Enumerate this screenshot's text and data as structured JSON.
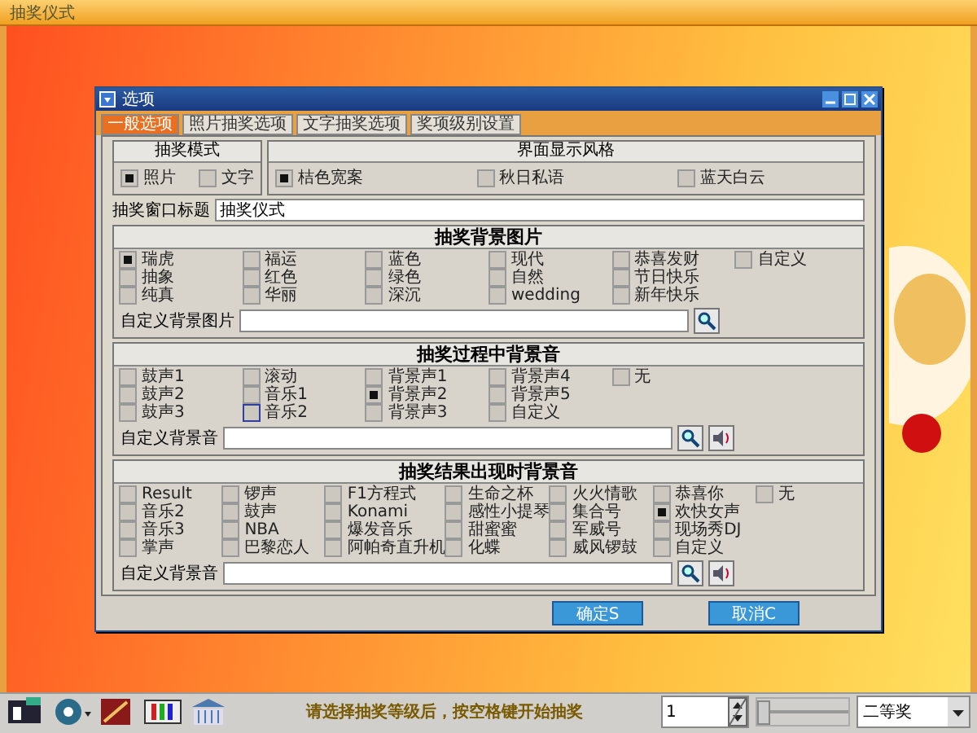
{
  "window": {
    "title": "抽奖仪式"
  },
  "dialog": {
    "title": "选项",
    "tabs": [
      {
        "label": "一般选项",
        "selected": true
      },
      {
        "label": "照片抽奖选项",
        "selected": false
      },
      {
        "label": "文字抽奖选项",
        "selected": false
      },
      {
        "label": "奖项级别设置",
        "selected": false
      }
    ],
    "mode_panel": {
      "heading": "抽奖模式",
      "options": [
        {
          "label": "照片",
          "checked": true
        },
        {
          "label": "文字",
          "checked": false
        }
      ]
    },
    "style_panel": {
      "heading": "界面显示风格",
      "options": [
        {
          "label": "桔色宽案",
          "checked": true
        },
        {
          "label": "秋日私语",
          "checked": false
        },
        {
          "label": "蓝天白云",
          "checked": false
        }
      ]
    },
    "title_field": {
      "label": "抽奖窗口标题",
      "value": "抽奖仪式"
    },
    "sections": [
      {
        "heading": "抽奖背景图片",
        "rows": [
          [
            {
              "label": "瑞虎",
              "checked": true
            },
            {
              "label": "福运",
              "checked": false
            },
            {
              "label": "蓝色",
              "checked": false
            },
            {
              "label": "现代",
              "checked": false
            },
            {
              "label": "恭喜发财",
              "checked": false
            },
            {
              "label": "自定义",
              "checked": false
            }
          ],
          [
            {
              "label": "抽象",
              "checked": false
            },
            {
              "label": "红色",
              "checked": false
            },
            {
              "label": "绿色",
              "checked": false
            },
            {
              "label": "自然",
              "checked": false
            },
            {
              "label": "节日快乐",
              "checked": false
            }
          ],
          [
            {
              "label": "纯真",
              "checked": false
            },
            {
              "label": "华丽",
              "checked": false
            },
            {
              "label": "深沉",
              "checked": false
            },
            {
              "label": "wedding",
              "checked": false
            },
            {
              "label": "新年快乐",
              "checked": false
            }
          ]
        ],
        "custom": {
          "label": "自定义背景图片",
          "kind": "image"
        }
      },
      {
        "heading": "抽奖过程中背景音",
        "rows": [
          [
            {
              "label": "鼓声1",
              "checked": false
            },
            {
              "label": "滚动",
              "checked": false
            },
            {
              "label": "背景声1",
              "checked": false
            },
            {
              "label": "背景声4",
              "checked": false
            },
            {
              "label": "无",
              "checked": false
            }
          ],
          [
            {
              "label": "鼓声2",
              "checked": false
            },
            {
              "label": "音乐1",
              "checked": false
            },
            {
              "label": "背景声2",
              "checked": true
            },
            {
              "label": "背景声5",
              "checked": false
            }
          ],
          [
            {
              "label": "鼓声3",
              "checked": false
            },
            {
              "label": "音乐2",
              "checked": false,
              "focused": true
            },
            {
              "label": "背景声3",
              "checked": false
            },
            {
              "label": "自定义",
              "checked": false
            }
          ]
        ],
        "custom": {
          "label": "自定义背景音",
          "kind": "sound"
        }
      },
      {
        "heading": "抽奖结果出现时背景音",
        "rows": [
          [
            {
              "label": "Result",
              "checked": false
            },
            {
              "label": "锣声",
              "checked": false
            },
            {
              "label": "F1方程式",
              "checked": false
            },
            {
              "label": "生命之杯",
              "checked": false
            },
            {
              "label": "火火情歌",
              "checked": false
            },
            {
              "label": "恭喜你",
              "checked": false
            },
            {
              "label": "无",
              "checked": false
            }
          ],
          [
            {
              "label": "音乐2",
              "checked": false
            },
            {
              "label": "鼓声",
              "checked": false
            },
            {
              "label": "Konami",
              "checked": false
            },
            {
              "label": "感性小提琴",
              "checked": false
            },
            {
              "label": "集合号",
              "checked": false
            },
            {
              "label": "欢快女声",
              "checked": true
            }
          ],
          [
            {
              "label": "音乐3",
              "checked": false
            },
            {
              "label": "NBA",
              "checked": false
            },
            {
              "label": "爆发音乐",
              "checked": false
            },
            {
              "label": "甜蜜蜜",
              "checked": false
            },
            {
              "label": "军威号",
              "checked": false
            },
            {
              "label": "现场秀DJ",
              "checked": false
            }
          ],
          [
            {
              "label": "掌声",
              "checked": false
            },
            {
              "label": "巴黎恋人",
              "checked": false
            },
            {
              "label": "阿帕奇直升机",
              "checked": false
            },
            {
              "label": "化蝶",
              "checked": false
            },
            {
              "label": "威风锣鼓",
              "checked": false
            },
            {
              "label": "自定义",
              "checked": false
            }
          ]
        ],
        "custom": {
          "label": "自定义背景音",
          "kind": "sound"
        }
      }
    ],
    "buttons": [
      "确定S",
      "取消C"
    ]
  },
  "toolbar": {
    "status": "请选择抽奖等级后，按空格键开始抽奖",
    "spinner_value": "1",
    "slider": {
      "level": 0
    },
    "prize_select": "二等奖"
  }
}
